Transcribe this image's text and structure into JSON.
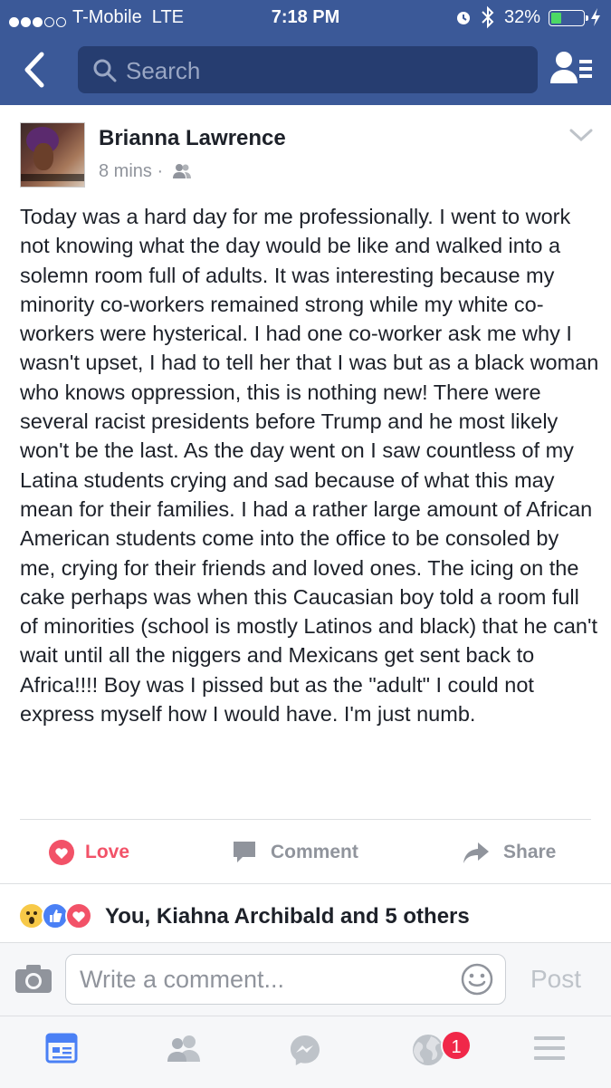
{
  "status_bar": {
    "carrier": "T-Mobile  LTE",
    "time": "7:18 PM",
    "battery_percent": "32%",
    "battery_level": 0.32
  },
  "nav": {
    "search_placeholder": "Search",
    "icons": [
      "back-arrow-icon",
      "search-icon",
      "friend-requests-icon"
    ]
  },
  "post": {
    "author": "Brianna Lawrence",
    "time_ago": "8 mins",
    "separator": "·",
    "audience_icon": "friends-icon",
    "text": "Today was a hard day for me professionally. I went to work not knowing what the day would be like and walked into a solemn room full of adults. It was interesting because my minority co-workers remained strong while my white co-workers were hysterical. I had one co-worker ask me why I wasn't upset, I had to tell her that I was but as a black woman who knows oppression, this is nothing new! There were several racist presidents before Trump and he most likely won't be the last. As the day went on I saw countless of my Latina students crying and sad because of what this may mean for their families. I had a rather large amount of African American students come into the office to be consoled by me, crying for their friends and loved ones. The icing on the cake perhaps was when this Caucasian boy told a room full of minorities (school is mostly Latinos and black) that he can't wait until all the niggers and Mexicans get sent back to Africa!!!! Boy was I pissed but as the \"adult\" I could not express myself how I would have. I'm just numb."
  },
  "actions": {
    "love": "Love",
    "comment": "Comment",
    "share": "Share"
  },
  "reactions": {
    "summary": "You, Kiahna Archibald and 5 others",
    "types": [
      "wow",
      "like",
      "love"
    ]
  },
  "composer": {
    "placeholder": "Write a comment...",
    "post_label": "Post"
  },
  "tabbar": {
    "tabs": [
      "news-feed",
      "friends",
      "messenger",
      "notifications",
      "menu"
    ],
    "notification_count": "1"
  },
  "colors": {
    "brand": "#3b5998",
    "love": "#f25268",
    "muted": "#90949c",
    "badge": "#f02849"
  }
}
